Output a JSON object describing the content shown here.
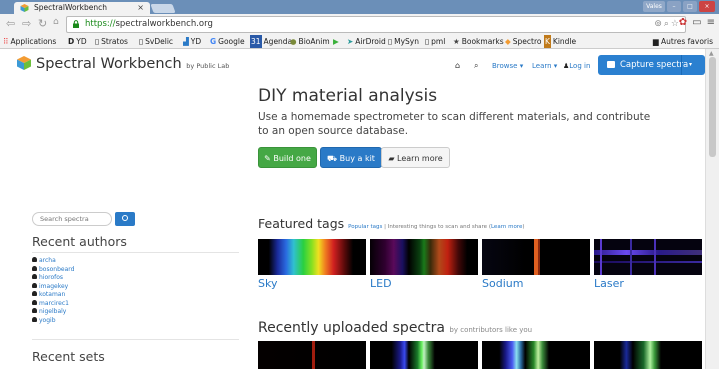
{
  "browser": {
    "tab_title": "SpectralWorkbench",
    "tab_close": "×",
    "window_user": "Vales",
    "url_scheme": "https://",
    "url_rest": "spectralworkbench.org",
    "bookmarks": [
      {
        "label": "Applications",
        "icon": "apps-grid-icon"
      },
      {
        "label": "YD",
        "icon": "d-logo-icon"
      },
      {
        "label": "Stratos",
        "icon": "page-icon"
      },
      {
        "label": "SvDelic",
        "icon": "page-icon"
      },
      {
        "label": "YD",
        "icon": "bars-icon"
      },
      {
        "label": "Google",
        "icon": "g-icon"
      },
      {
        "label": "Agenda",
        "icon": "calendar-icon"
      },
      {
        "label": "BioAnim",
        "icon": "circle-icon"
      },
      {
        "label": "",
        "icon": "play-icon"
      },
      {
        "label": "AirDroid",
        "icon": "arrow-icon"
      },
      {
        "label": "MySyn",
        "icon": "page-icon"
      },
      {
        "label": "pml",
        "icon": "page-icon"
      },
      {
        "label": "Bookmarks",
        "icon": "star-icon"
      },
      {
        "label": "Spectro",
        "icon": "cube-icon"
      },
      {
        "label": "Kindle",
        "icon": "k-icon"
      }
    ],
    "bookmarks_right": "Autres favoris"
  },
  "header": {
    "brand": "Spectral Workbench",
    "brand_by": "by Public Lab",
    "browse": "Browse ▾",
    "learn": "Learn ▾",
    "login": "Log in",
    "capture": "Capture spectra",
    "capture_caret": "▾"
  },
  "hero": {
    "title": "DIY material analysis",
    "description": "Use a homemade spectrometer to scan different materials, and contribute to an open source database.",
    "build": "Build one",
    "kit": "Buy a kit",
    "learn_more": "Learn more"
  },
  "sidebar": {
    "search_placeholder": "Search spectra",
    "recent_authors_title": "Recent authors",
    "authors": [
      "archa",
      "bosonbeard",
      "hiorofos",
      "imagekey",
      "kotaman",
      "marcirec1",
      "nigelbaly",
      "yogib"
    ],
    "recent_sets_title": "Recent sets"
  },
  "featured": {
    "title": "Featured tags",
    "popular": "Popular tags",
    "subtitle": " | Interesting things to scan and share (",
    "learn_link": "Learn more",
    "subtitle_end": ")",
    "tags": [
      "Sky",
      "LED",
      "Sodium",
      "Laser"
    ]
  },
  "recent": {
    "title": "Recently uploaded spectra",
    "subtitle": "by contributors like you"
  },
  "colors": {
    "accent_blue": "#2a7ac7",
    "build_green": "#45a845",
    "tab_bar": "#6b8fb8"
  }
}
